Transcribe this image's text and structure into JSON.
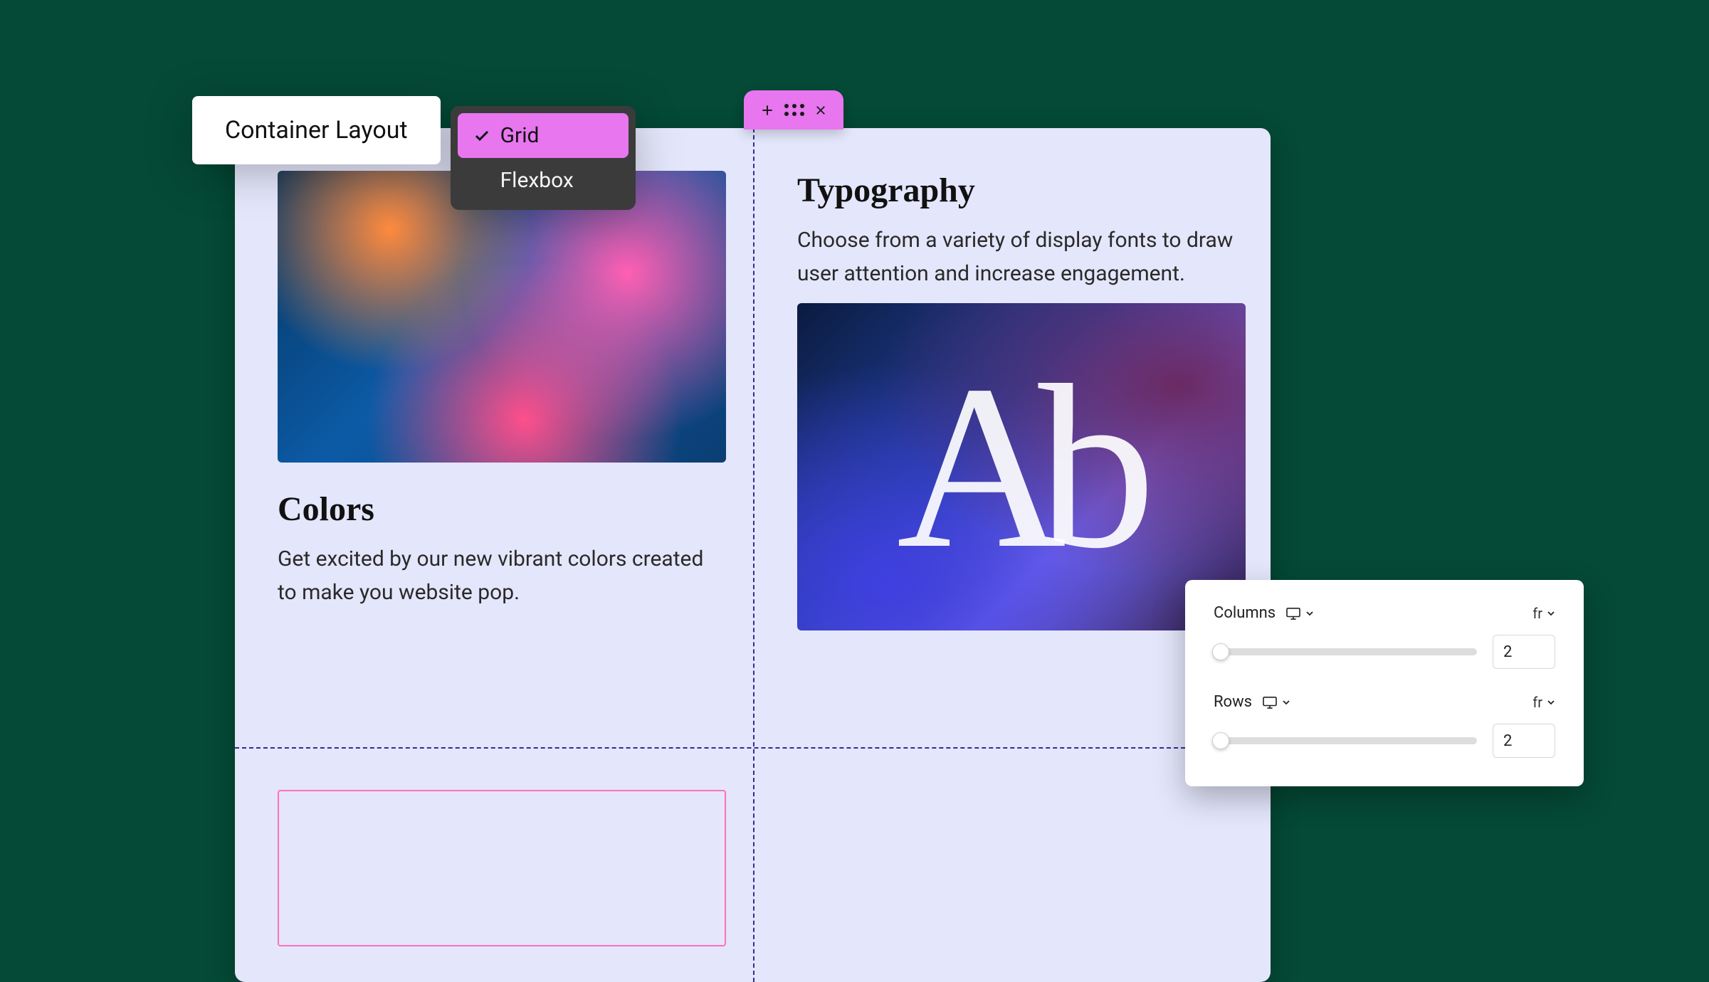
{
  "layout_popover": {
    "label": "Container Layout",
    "options": [
      {
        "label": "Grid",
        "selected": true
      },
      {
        "label": "Flexbox",
        "selected": false
      }
    ]
  },
  "block_handle": {
    "add_icon": "plus-icon",
    "drag_icon": "drag-handle-icon",
    "close_icon": "close-icon"
  },
  "cards": {
    "left": {
      "title": "Colors",
      "body": "Get excited by our new vibrant colors created to make you website pop."
    },
    "right": {
      "title": "Typography",
      "body": "Choose from a variety of display fonts to draw user attention and increase engagement.",
      "sample_glyph_a": "A",
      "sample_glyph_b": "b"
    }
  },
  "grid_panel": {
    "columns": {
      "label": "Columns",
      "unit": "fr",
      "value": "2"
    },
    "rows": {
      "label": "Rows",
      "unit": "fr",
      "value": "2"
    }
  }
}
